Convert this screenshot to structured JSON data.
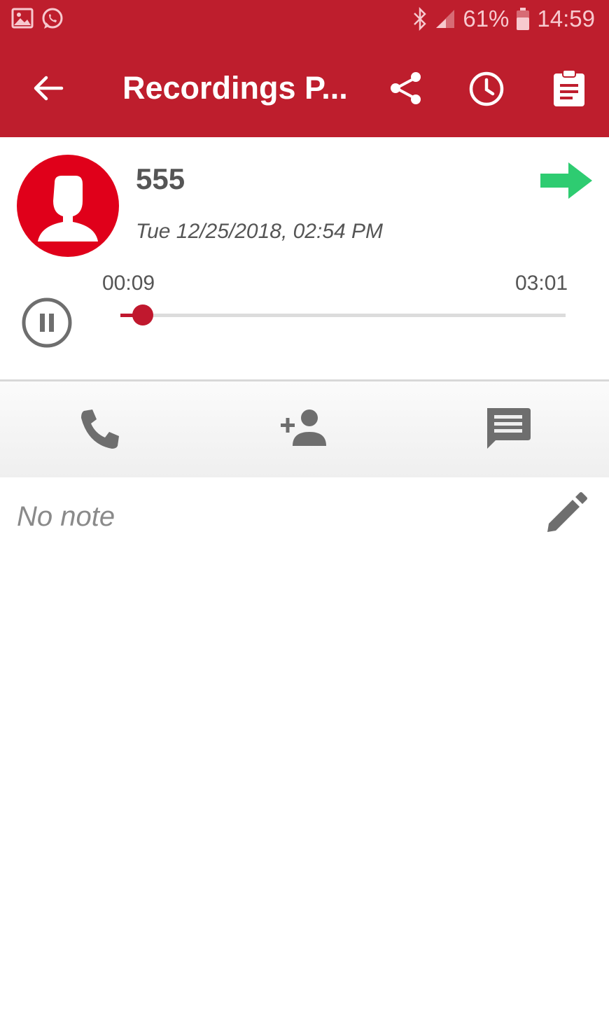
{
  "status_bar": {
    "battery": "61%",
    "time": "14:59",
    "icons": [
      "gallery-icon",
      "whatsapp-icon",
      "bluetooth-icon",
      "signal-icon",
      "battery-icon"
    ]
  },
  "app_bar": {
    "title": "Recordings P...",
    "icons": [
      "back-arrow-icon",
      "share-icon",
      "clock-icon",
      "clipboard-icon"
    ]
  },
  "recording": {
    "contact_name": "555",
    "date": "Tue 12/25/2018, 02:54 PM",
    "direction_icon": "outgoing-arrow-icon",
    "current_time": "00:09",
    "total_time": "03:01",
    "progress_fraction": 0.05,
    "state": "playing"
  },
  "actions": [
    {
      "name": "call-button",
      "icon": "phone-icon"
    },
    {
      "name": "add-contact-button",
      "icon": "add-person-icon"
    },
    {
      "name": "message-button",
      "icon": "message-icon"
    }
  ],
  "note": {
    "text": "No note",
    "edit_icon": "pencil-icon"
  },
  "colors": {
    "brand_red": "#be1e2d",
    "avatar_red": "#e0001a",
    "arrow_green": "#2ecc71",
    "icon_gray": "#6e6e6e"
  }
}
